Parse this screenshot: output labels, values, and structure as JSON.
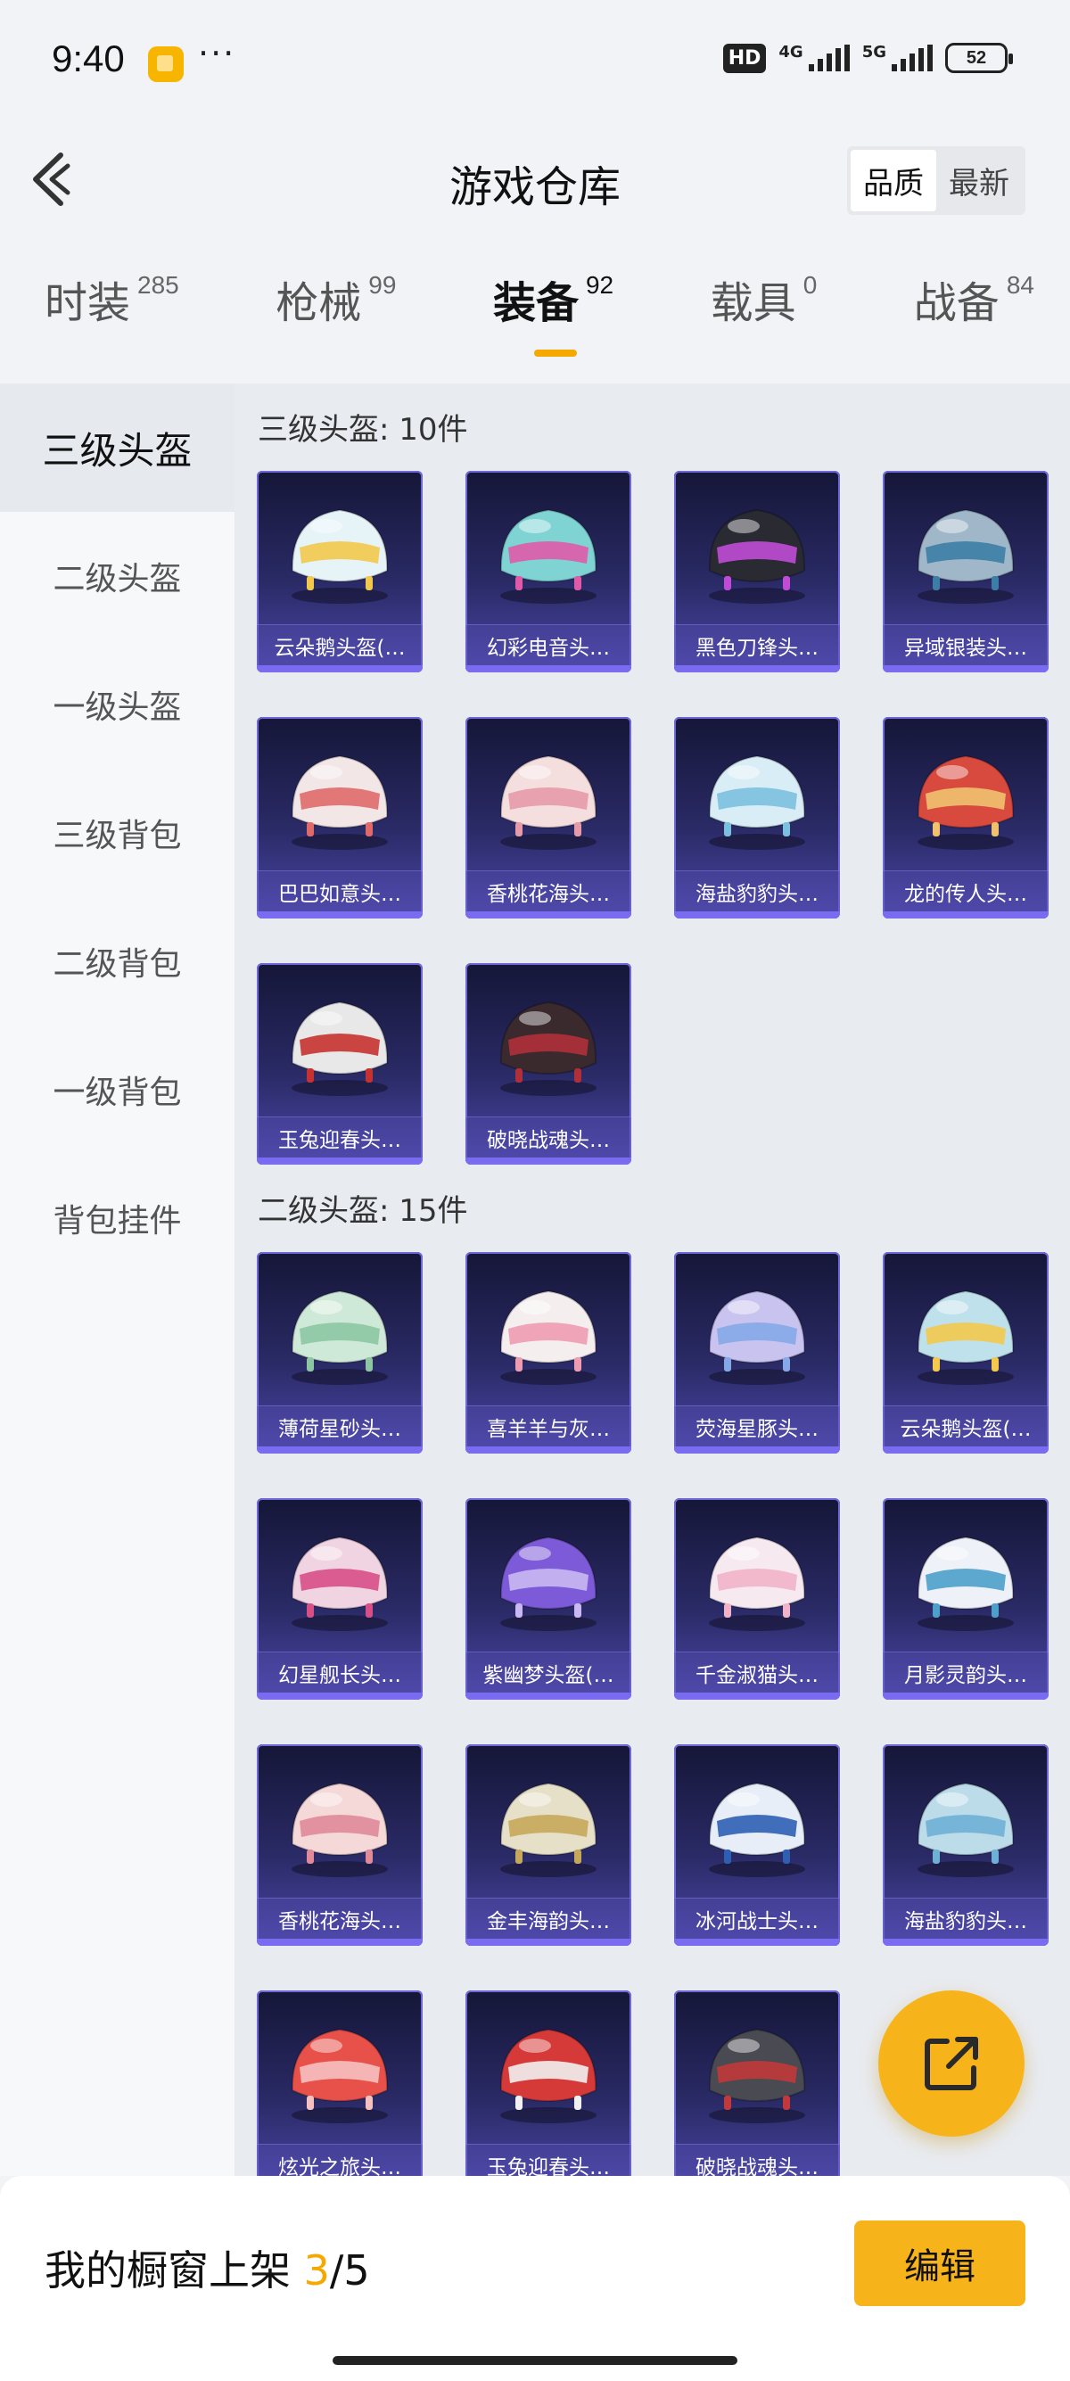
{
  "status_bar": {
    "time": "9:40",
    "dots": "···",
    "hd_badge": "HD",
    "network_1": "4G",
    "network_2": "5G",
    "battery": "52"
  },
  "header": {
    "title": "游戏仓库",
    "sort_options": [
      "品质",
      "最新"
    ],
    "active_sort": "品质"
  },
  "tabs": [
    {
      "label": "时装",
      "count": "285",
      "active": false
    },
    {
      "label": "枪械",
      "count": "99",
      "active": false
    },
    {
      "label": "装备",
      "count": "92",
      "active": true
    },
    {
      "label": "载具",
      "count": "0",
      "active": false
    },
    {
      "label": "战备",
      "count": "84",
      "active": false
    }
  ],
  "sidebar": {
    "items": [
      {
        "label": "三级头盔",
        "active": true
      },
      {
        "label": "二级头盔",
        "active": false
      },
      {
        "label": "一级头盔",
        "active": false
      },
      {
        "label": "三级背包",
        "active": false
      },
      {
        "label": "二级背包",
        "active": false
      },
      {
        "label": "一级背包",
        "active": false
      },
      {
        "label": "背包挂件",
        "active": false
      }
    ]
  },
  "sections": [
    {
      "title": "三级头盔: 10件",
      "items": [
        {
          "name": "云朵鹅头盔(…",
          "icon": "goose-helmet-icon",
          "color": "#e6f3f7",
          "accent": "#f2c94c"
        },
        {
          "name": "幻彩电音头…",
          "icon": "music-helmet-icon",
          "color": "#7fd3d3",
          "accent": "#e05aa9"
        },
        {
          "name": "黑色刀锋头…",
          "icon": "blade-helmet-icon",
          "color": "#2a2a33",
          "accent": "#c04bd6"
        },
        {
          "name": "异域银装头…",
          "icon": "silver-helmet-icon",
          "color": "#9fb7c9",
          "accent": "#3c7ea6"
        },
        {
          "name": "巴巴如意头…",
          "icon": "ruyi-helmet-icon",
          "color": "#f3e6e6",
          "accent": "#e06a6a"
        },
        {
          "name": "香桃花海头…",
          "icon": "peach-helmet-icon",
          "color": "#f5dede",
          "accent": "#e79aa8"
        },
        {
          "name": "海盐豹豹头…",
          "icon": "leopard-helmet-icon",
          "color": "#d8edf5",
          "accent": "#7cc0df"
        },
        {
          "name": "龙的传人头…",
          "icon": "dragon-helmet-icon",
          "color": "#d94a3e",
          "accent": "#f0c270"
        },
        {
          "name": "玉兔迎春头…",
          "icon": "rabbit-helmet-icon",
          "color": "#e8e8e8",
          "accent": "#c6322f"
        },
        {
          "name": "破晓战魂头…",
          "icon": "spiked-helmet-icon",
          "color": "#3a2a2e",
          "accent": "#b0303a"
        }
      ]
    },
    {
      "title": "二级头盔: 15件",
      "items": [
        {
          "name": "薄荷星砂头…",
          "icon": "mint-helmet-icon",
          "color": "#cfe9d8",
          "accent": "#8cc6a3"
        },
        {
          "name": "喜羊羊与灰…",
          "icon": "sheep-helmet-icon",
          "color": "#f4eeee",
          "accent": "#ef9bb0"
        },
        {
          "name": "荧海星豚头…",
          "icon": "dolphin-helmet-icon",
          "color": "#c9c3ef",
          "accent": "#84a8e8"
        },
        {
          "name": "云朵鹅头盔(…",
          "icon": "goose-helmet-icon",
          "color": "#bfe1ec",
          "accent": "#f2c94c"
        },
        {
          "name": "幻星舰长头…",
          "icon": "captain-helmet-icon",
          "color": "#f0d4e2",
          "accent": "#d84f88"
        },
        {
          "name": "紫幽梦头盔(…",
          "icon": "dream-helmet-icon",
          "color": "#7d5ad8",
          "accent": "#c9b8f2"
        },
        {
          "name": "千金淑猫头…",
          "icon": "cat-helmet-icon",
          "color": "#f6eaf0",
          "accent": "#f2b3c8"
        },
        {
          "name": "月影灵韵头…",
          "icon": "moon-helmet-icon",
          "color": "#eef1f7",
          "accent": "#4da0c9"
        },
        {
          "name": "香桃花海头…",
          "icon": "peach-helmet-icon",
          "color": "#f5d8d8",
          "accent": "#e08a9a"
        },
        {
          "name": "金丰海韵头…",
          "icon": "golden-helmet-icon",
          "color": "#e6e0c8",
          "accent": "#c6a85a"
        },
        {
          "name": "冰河战士头…",
          "icon": "glacier-helmet-icon",
          "color": "#e8eef7",
          "accent": "#2f5fb3"
        },
        {
          "name": "海盐豹豹头…",
          "icon": "leopard-helmet-icon",
          "color": "#bcdcea",
          "accent": "#6fb0d6"
        },
        {
          "name": "炫光之旅头…",
          "icon": "journey-helmet-icon",
          "color": "#e8504a",
          "accent": "#f6c0c0"
        },
        {
          "name": "玉兔迎春头…",
          "icon": "rabbit-helmet-icon",
          "color": "#d63a38",
          "accent": "#f1f1f1"
        },
        {
          "name": "破晓战魂头…",
          "icon": "spiked-helmet-icon",
          "color": "#4a4a52",
          "accent": "#c1393a"
        }
      ]
    }
  ],
  "bottom_bar": {
    "showcase_label": "我的橱窗上架",
    "showcase_current": "3",
    "showcase_total": "/5",
    "edit_label": "编辑"
  },
  "colors": {
    "accent": "#f7b31a",
    "card_bg": "#2a2a66",
    "card_border": "#6f68d8"
  }
}
